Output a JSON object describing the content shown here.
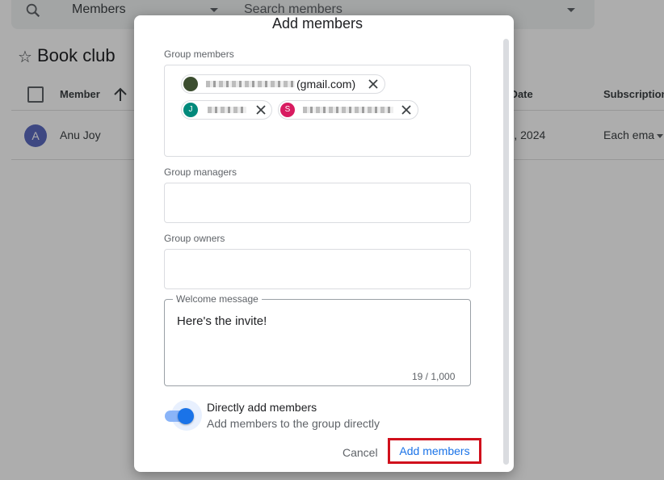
{
  "background": {
    "search": {
      "select_value": "Members",
      "placeholder": "Search members"
    },
    "group_title": "Book club",
    "table": {
      "headers": {
        "member": "Member",
        "join_date": "n Date",
        "subscription": "Subscription"
      },
      "rows": [
        {
          "avatar_letter": "A",
          "name": "Anu Joy",
          "join_date": "r 9, 2024",
          "subscription": "Each ema"
        }
      ]
    }
  },
  "dialog": {
    "title": "Add members",
    "group_members": {
      "label": "Group members",
      "chips": [
        {
          "avatar_letter": "",
          "avatar_color": "#3b4d2f",
          "text": "(gmail.com)"
        },
        {
          "avatar_letter": "J",
          "avatar_color": "#00897b",
          "text": ""
        },
        {
          "avatar_letter": "S",
          "avatar_color": "#d81b60",
          "text": ""
        }
      ]
    },
    "group_managers": {
      "label": "Group managers"
    },
    "group_owners": {
      "label": "Group owners"
    },
    "welcome_message": {
      "label": "Welcome message",
      "value": "Here's the invite!",
      "counter": "19 / 1,000"
    },
    "direct_add": {
      "title": "Directly add members",
      "description": "Add members to the group directly",
      "enabled": true
    },
    "buttons": {
      "cancel": "Cancel",
      "add": "Add members"
    }
  },
  "colors": {
    "accent": "#1a73e8",
    "highlight_border": "#d0101c"
  }
}
